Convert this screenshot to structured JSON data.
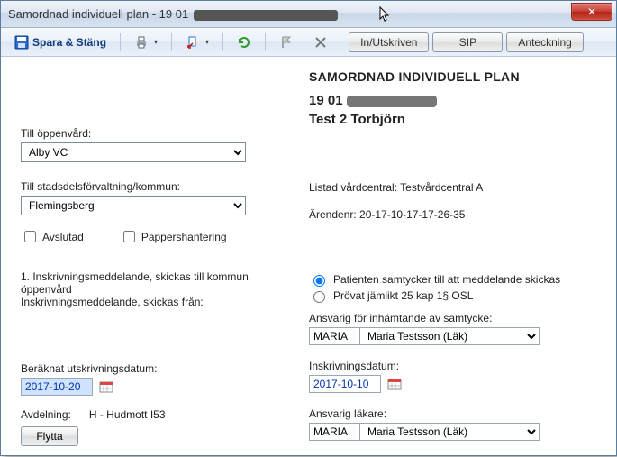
{
  "window": {
    "title_prefix": "Samordnad individuell plan - 19 01"
  },
  "toolbar": {
    "save_close": "Spara & Stäng",
    "btn_inut": "In/Utskriven",
    "btn_sip": "SIP",
    "btn_note": "Anteckning"
  },
  "header": {
    "title": "SAMORDNAD INDIVIDUELL PLAN",
    "pid_prefix": "19  01",
    "name": "Test 2 Torbjörn"
  },
  "left": {
    "oppenvard_label": "Till öppenvård:",
    "oppenvard_value": "Alby VC",
    "stads_label": "Till stadsdelsförvaltning/kommun:",
    "stads_value": "Flemingsberg",
    "avslutad": "Avslutad",
    "pappers": "Pappershantering"
  },
  "right_info": {
    "listad_label": "Listad vårdcentral: ",
    "listad_value": "Testvårdcentral A",
    "arendenr_label": "Ärendenr: ",
    "arendenr_value": "20-17-10-17-17-26-35"
  },
  "section": {
    "lead": "1. Inskrivningsmeddelande, skickas till kommun, öppenvård",
    "sub": "Inskrivningsmeddelande, skickas från:",
    "radio1": "Patienten samtycker till att meddelande skickas",
    "radio2": "Prövat jämlikt 25 kap 1§ OSL",
    "ansvarig_samtycke": "Ansvarig för inhämtande av samtycke:",
    "code": "MARIA",
    "name": "Maria Testsson (Läk)",
    "berk_label": "Beräknat utskrivningsdatum:",
    "berk_value": "2017-10-20",
    "inskr_label": "Inskrivningsdatum:",
    "inskr_value": "2017-10-10",
    "avdelning_label": "Avdelning:",
    "avdelning_value": "H - Hudmott I53",
    "flytta": "Flytta",
    "ansvarig_lakare": "Ansvarig läkare:"
  }
}
